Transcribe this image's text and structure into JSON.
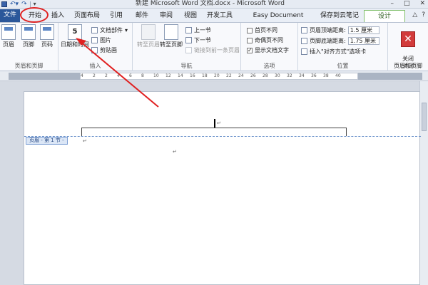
{
  "window": {
    "title": "新建 Microsoft Word 文档.docx - Microsoft Word",
    "min_label": "–",
    "max_label": "□",
    "close_label": "✕"
  },
  "tabs": [
    {
      "label": "文件"
    },
    {
      "label": "开始"
    },
    {
      "label": "插入"
    },
    {
      "label": "页面布局"
    },
    {
      "label": "引用"
    },
    {
      "label": "邮件"
    },
    {
      "label": "审阅"
    },
    {
      "label": "视图"
    },
    {
      "label": "开发工具"
    },
    {
      "label": "Easy Document Creator"
    },
    {
      "label": "保存到云笔记"
    },
    {
      "label": "设计"
    }
  ],
  "ribbon": {
    "group_header_footer": {
      "label": "页眉和页脚",
      "btn_header": "页眉",
      "btn_footer": "页脚",
      "btn_pagenum": "页码"
    },
    "group_insert": {
      "label": "插入",
      "btn_datetime": "日期和时间",
      "doc_parts": "文档部件",
      "picture": "图片",
      "clipart": "剪贴画"
    },
    "group_nav": {
      "label": "导航",
      "goto_header": "转至页眉",
      "goto_footer": "转至页脚",
      "prev_section": "上一节",
      "next_section": "下一节",
      "link_prev": "链接到前一条页眉"
    },
    "group_options": {
      "label": "选项",
      "diff_first": "首页不同",
      "diff_odd_even": "奇偶页不同",
      "show_doc_text": "显示文档文字"
    },
    "group_position": {
      "label": "位置",
      "header_dist_label": "页眉顶端距离:",
      "header_dist_value": "1.5 厘米",
      "footer_dist_label": "页脚底端距离:",
      "footer_dist_value": "1.75 厘米",
      "insert_align_tab": "插入\"对齐方式\"选项卡"
    },
    "group_close": {
      "label": "关闭",
      "btn_close": "关闭\n页眉和页脚"
    }
  },
  "ruler": {
    "numbers": [
      "4",
      "2",
      "2",
      "4",
      "6",
      "8",
      "10",
      "12",
      "14",
      "16",
      "18",
      "20",
      "22",
      "24",
      "26",
      "28",
      "30",
      "32",
      "34",
      "36",
      "38",
      "40"
    ]
  },
  "document": {
    "header_tag": "页眉 - 第 1 节 -",
    "para_mark": "↵"
  },
  "colors": {
    "file_tab": "#2b579a",
    "design_tab_border": "#7fbf6a",
    "annotation_red": "#e02020",
    "header_dash": "#6f95cc"
  }
}
